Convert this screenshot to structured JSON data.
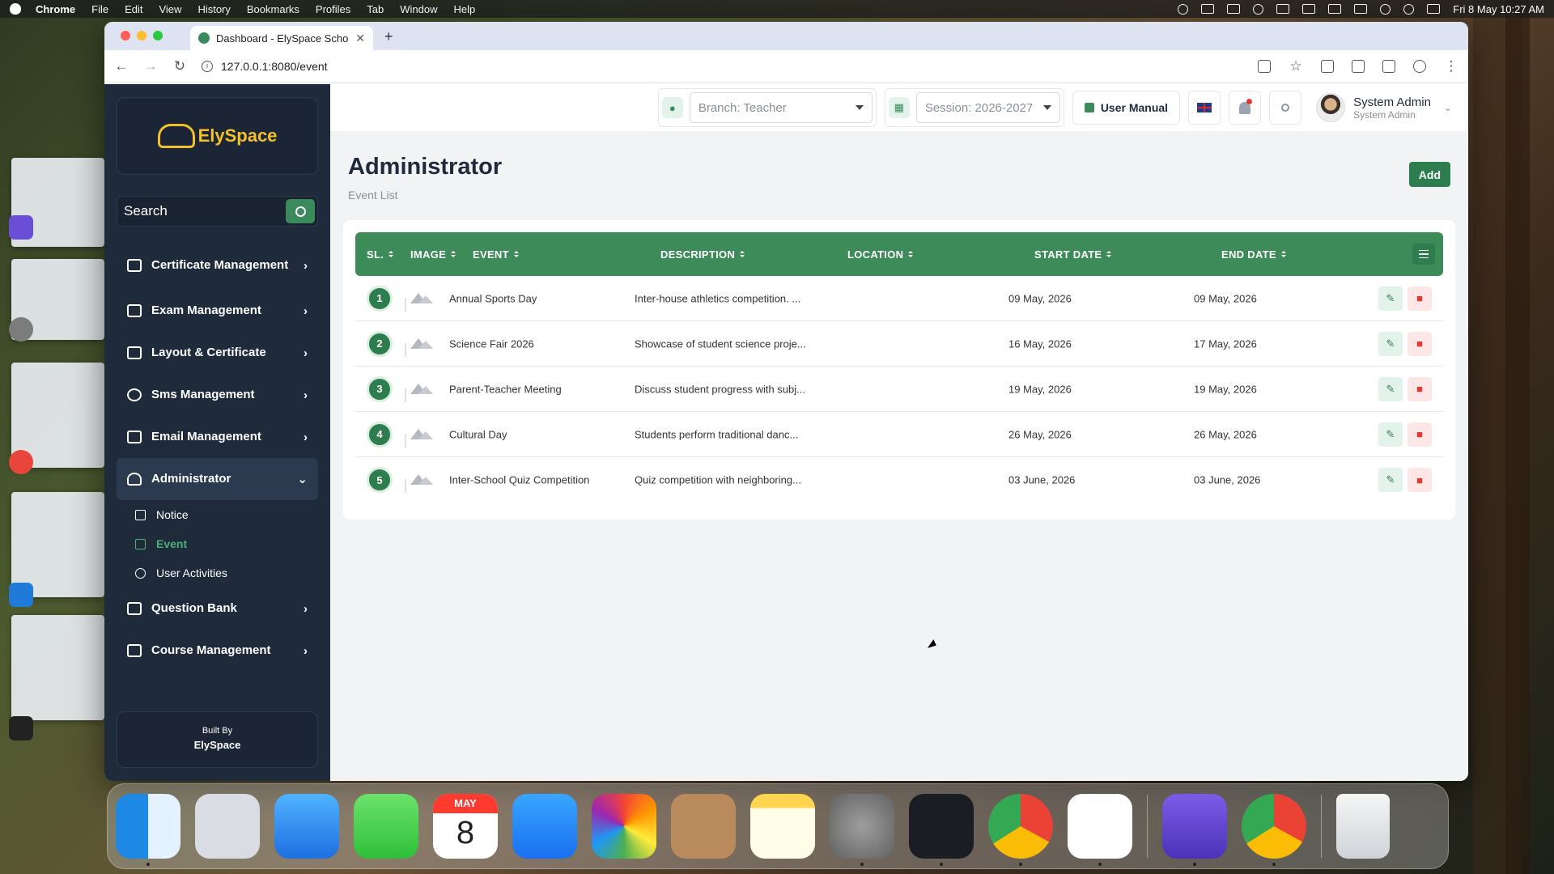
{
  "menubar": {
    "app": "Chrome",
    "items": [
      "File",
      "Edit",
      "View",
      "History",
      "Bookmarks",
      "Profiles",
      "Tab",
      "Window",
      "Help"
    ],
    "clock": "Fri 8 May  10:27 AM"
  },
  "browser": {
    "tab_title": "Dashboard - ElySpace School",
    "url": "127.0.0.1:8080/event"
  },
  "sidebar": {
    "logo": "ElySpace",
    "search_placeholder": "Search",
    "menu": [
      {
        "label": "Certificate Management",
        "icon": "certificate-icon"
      },
      {
        "label": "Exam Management",
        "icon": "exam-icon"
      },
      {
        "label": "Layout & Certificate",
        "icon": "id-card-icon"
      },
      {
        "label": "Sms Management",
        "icon": "sms-icon"
      },
      {
        "label": "Email Management",
        "icon": "envelope-icon"
      },
      {
        "label": "Administrator",
        "icon": "admin-user-icon"
      },
      {
        "label": "Question Bank",
        "icon": "question-bank-icon"
      },
      {
        "label": "Course Management",
        "icon": "course-icon"
      }
    ],
    "submenu": [
      {
        "label": "Notice",
        "icon": "megaphone-icon"
      },
      {
        "label": "Event",
        "icon": "calendar-icon"
      },
      {
        "label": "User Activities",
        "icon": "history-icon"
      }
    ],
    "built_by_label": "Built By",
    "built_by_name": "ElySpace"
  },
  "topbar": {
    "branch": "Branch: Teacher",
    "session": "Session: 2026-2027",
    "user_manual": "User Manual",
    "user_name": "System Admin",
    "user_role": "System Admin"
  },
  "page": {
    "title": "Administrator",
    "subtitle": "Event List",
    "add_label": "Add"
  },
  "table": {
    "headers": {
      "sl": "SL.",
      "image": "IMAGE",
      "event": "EVENT",
      "description": "DESCRIPTION",
      "location": "LOCATION",
      "start": "START DATE",
      "end": "END DATE"
    },
    "rows": [
      {
        "sl": "1",
        "event": "Annual Sports Day",
        "description": "Inter-house athletics competition. ...",
        "location": "",
        "start": "09 May, 2026",
        "end": "09 May, 2026"
      },
      {
        "sl": "2",
        "event": "Science Fair 2026",
        "description": "Showcase of student science proje...",
        "location": "",
        "start": "16 May, 2026",
        "end": "17 May, 2026"
      },
      {
        "sl": "3",
        "event": "Parent-Teacher Meeting",
        "description": "Discuss student progress with subj...",
        "location": "",
        "start": "19 May, 2026",
        "end": "19 May, 2026"
      },
      {
        "sl": "4",
        "event": "Cultural Day",
        "description": "Students perform traditional danc...",
        "location": "",
        "start": "26 May, 2026",
        "end": "26 May, 2026"
      },
      {
        "sl": "5",
        "event": "Inter-School Quiz Competition",
        "description": "Quiz competition with neighboring...",
        "location": "",
        "start": "03 June, 2026",
        "end": "03 June, 2026"
      }
    ]
  },
  "dock": {
    "calendar_month": "MAY",
    "calendar_day": "8",
    "apps": [
      "finder-icon",
      "launchpad-icon",
      "mail-icon",
      "messages-icon",
      "calendar-icon",
      "app-store-icon",
      "photos-icon",
      "contacts-icon",
      "notes-icon",
      "system-settings-icon",
      "arc-icon",
      "chrome-icon",
      "vscode-icon",
      "database-icon",
      "chrome-icon",
      "trash-icon"
    ]
  },
  "colors": {
    "sidebar": "#1f2a3b",
    "accent_green": "#3d8b59",
    "delete_red": "#e53935",
    "brand_yellow": "#f4c02a"
  }
}
